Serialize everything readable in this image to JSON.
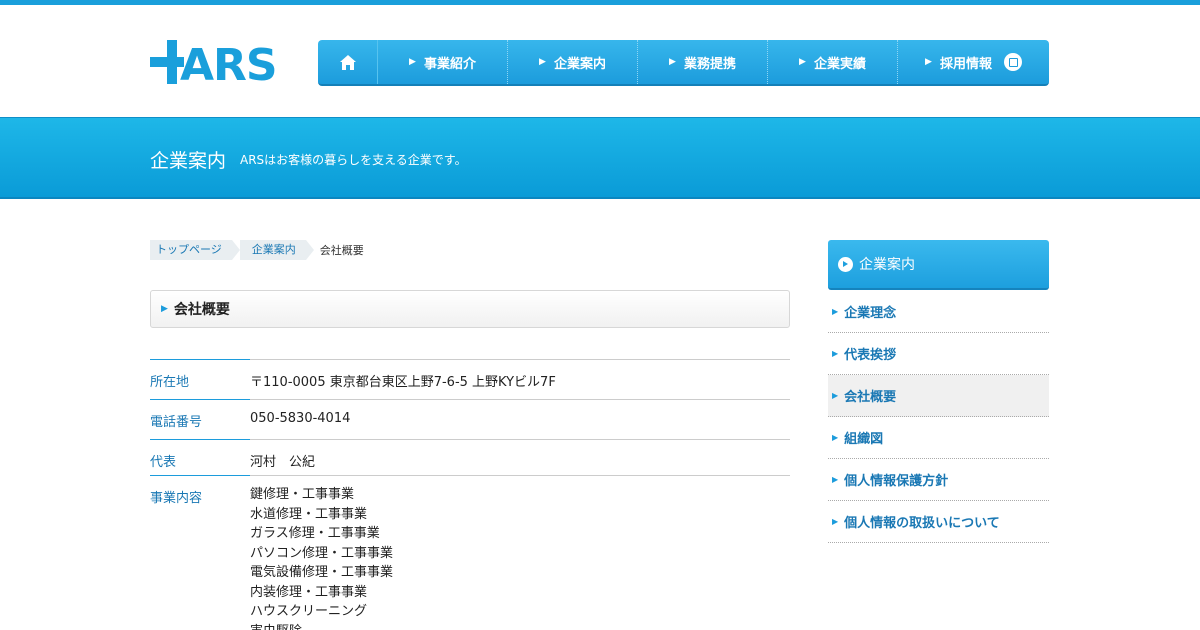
{
  "brand": {
    "logo_text": "+ARS",
    "accent": "#1a9fdb"
  },
  "nav": {
    "home_icon": "home-icon",
    "items": [
      {
        "label": "事業紹介"
      },
      {
        "label": "企業案内"
      },
      {
        "label": "業務提携"
      },
      {
        "label": "企業実績"
      },
      {
        "label": "採用情報"
      }
    ]
  },
  "hero": {
    "title": "企業案内",
    "subtitle": "ARSはお客様の暮らしを支える企業です。"
  },
  "breadcrumb": {
    "items": [
      "トップページ",
      "企業案内"
    ],
    "current": "会社概要"
  },
  "section": {
    "title": "会社概要"
  },
  "company": {
    "rows": [
      {
        "label": "所在地",
        "value": "〒110-0005 東京都台東区上野7-6-5 上野KYビル7F"
      },
      {
        "label": "電話番号",
        "value": "050-5830-4014"
      },
      {
        "label": "代表",
        "value": "河村　公紀"
      }
    ],
    "business": {
      "label": "事業内容",
      "lines": [
        "鍵修理・工事事業",
        "水道修理・工事事業",
        "ガラス修理・工事事業",
        "パソコン修理・工事事業",
        "電気設備修理・工事事業",
        "内装修理・工事事業",
        "ハウスクリーニング",
        "害虫駆除"
      ]
    }
  },
  "sidebar": {
    "title": "企業案内",
    "items": [
      {
        "label": "企業理念"
      },
      {
        "label": "代表挨拶"
      },
      {
        "label": "会社概要"
      },
      {
        "label": "組織図"
      },
      {
        "label": "個人情報保護方針"
      },
      {
        "label": "個人情報の取扱いについて"
      }
    ]
  }
}
